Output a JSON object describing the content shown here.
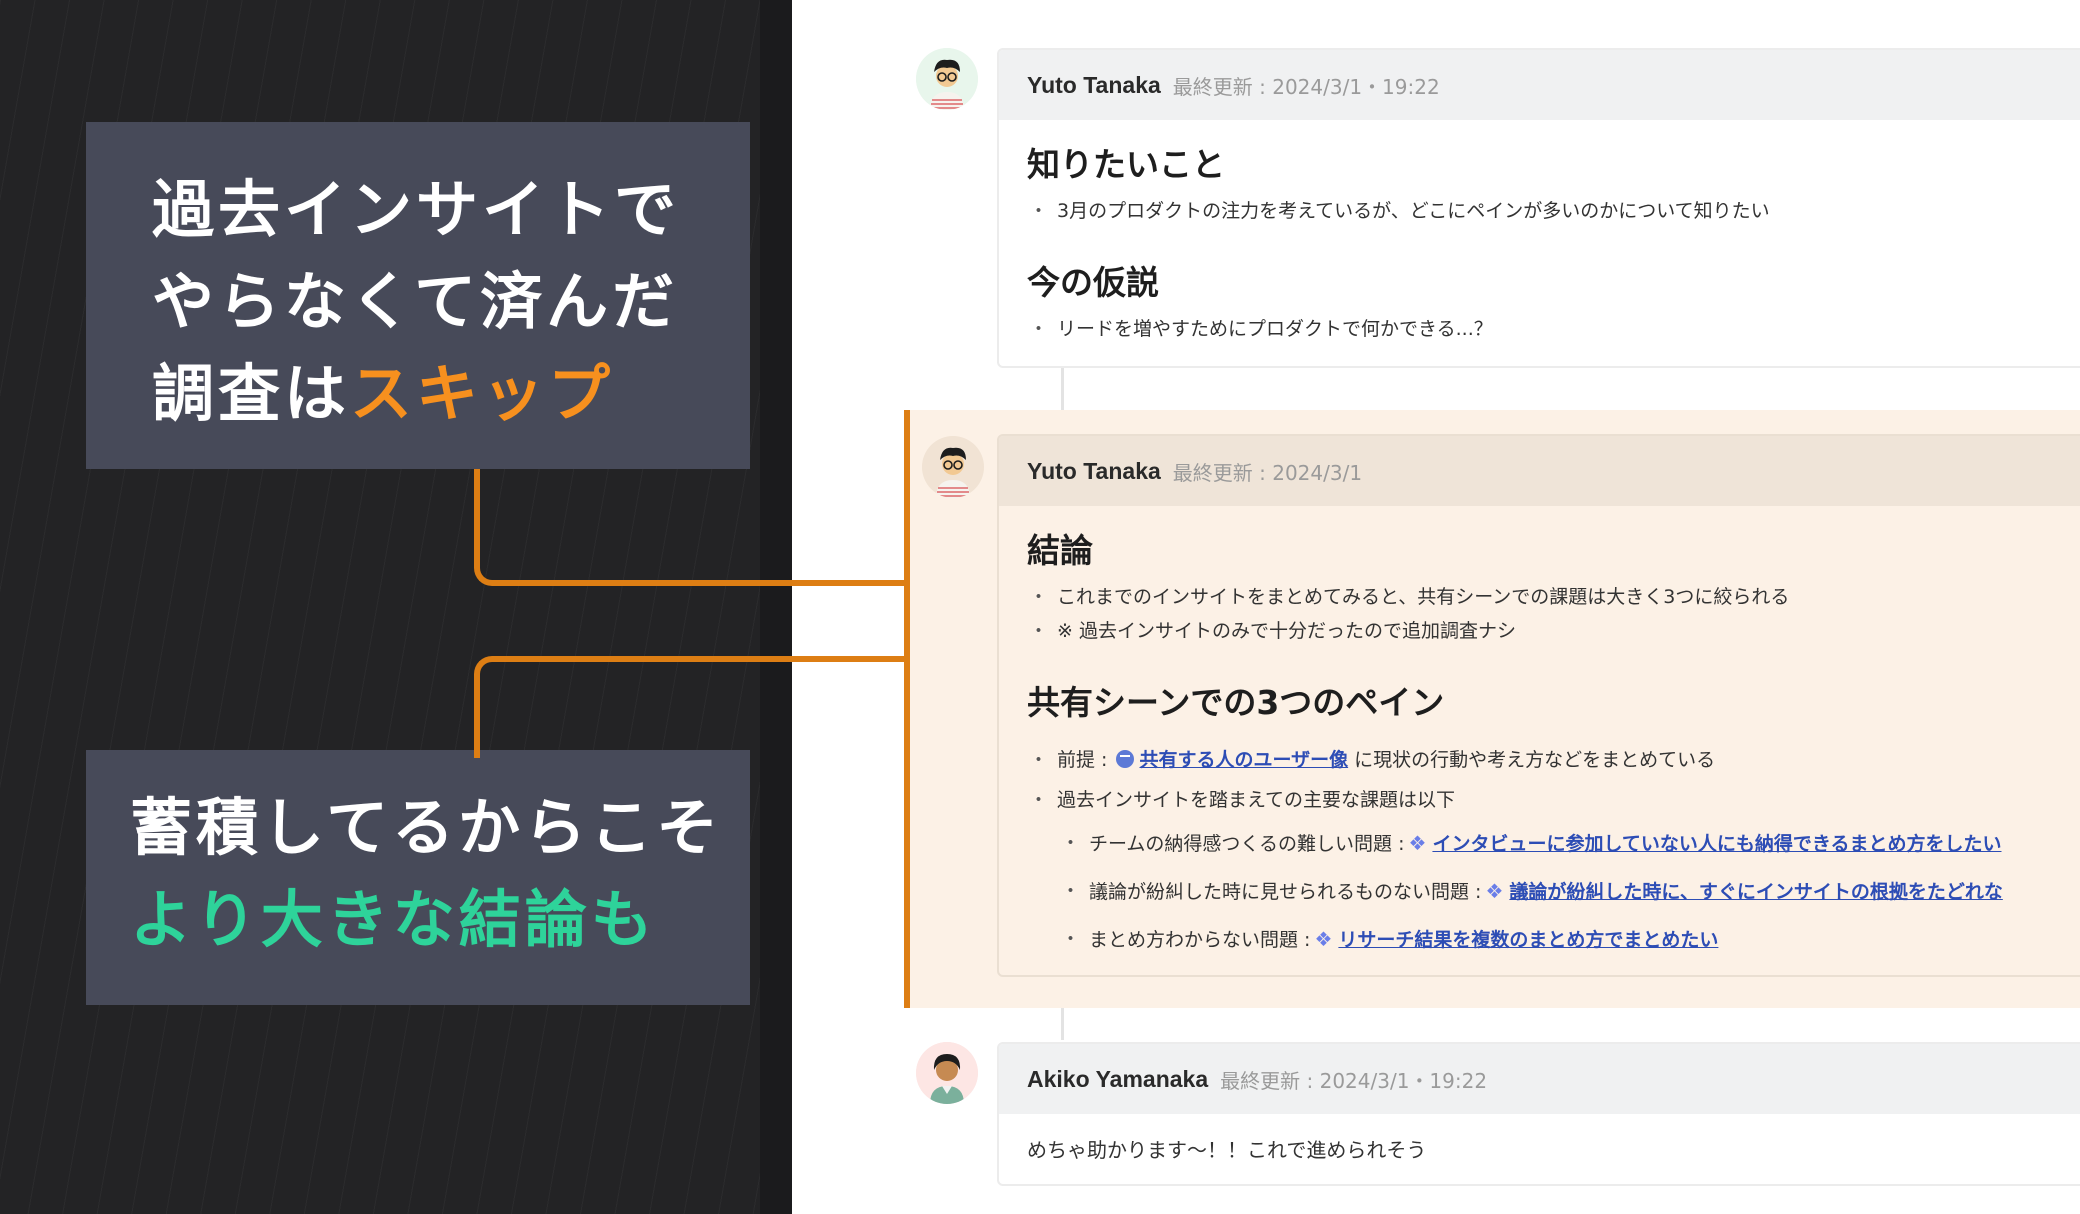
{
  "callouts": {
    "top": {
      "line1": "過去インサイトで",
      "line2": "やらなくて済んだ",
      "line3_prefix": "調査は",
      "line3_accent": "スキップ"
    },
    "bottom": {
      "line1": "蓄積してるからこそ",
      "line2_accent": "より大きな結論も"
    }
  },
  "colors": {
    "orange": "#f7901e",
    "green": "#2ed39a",
    "connector": "#dd7e14",
    "link": "#2d4db5"
  },
  "posts": [
    {
      "author": "Yuto Tanaka",
      "meta": "最終更新 : 2024/3/1・19:22",
      "sections": [
        {
          "heading": "知りたいこと",
          "bullets": [
            "3月のプロダクトの注力を考えているが、どこにペインが多いのかについて知りたい"
          ]
        },
        {
          "heading": "今の仮説",
          "bullets": [
            "リードを増やすためにプロダクトで何かできる...？"
          ]
        }
      ]
    },
    {
      "author": "Yuto Tanaka",
      "meta": "最終更新 : 2024/3/1",
      "conclusion": {
        "heading": "結論",
        "bullets": [
          "これまでのインサイトをまとめてみると、共有シーンでの課題は大きく3つに絞られる",
          "※ 過去インサイトのみで十分だったので追加調査ナシ"
        ]
      },
      "pains": {
        "heading": "共有シーンでの3つのペイン",
        "premise_label": "前提 :",
        "premise_link": "共有する人のユーザー像",
        "premise_suffix": "に現状の行動や考え方などをまとめている",
        "summary": "過去インサイトを踏まえての主要な課題は以下",
        "items": [
          {
            "label": "チームの納得感つくるの難しい問題 :",
            "link": "インタビューに参加していない人にも納得できるまとめ方をしたい"
          },
          {
            "label": "議論が紛糾した時に見せられるものない問題 :",
            "link": "議論が紛糾した時に、すぐにインサイトの根拠をたどれな"
          },
          {
            "label": "まとめ方わからない問題 :",
            "link": "リサーチ結果を複数のまとめ方でまとめたい"
          }
        ]
      }
    },
    {
      "author": "Akiko Yamanaka",
      "meta": "最終更新 : 2024/3/1・19:22",
      "text": "めちゃ助かります〜！！これで進められそう"
    }
  ],
  "icons": {
    "notion_page": "notion-page-icon",
    "people": "people-icon"
  }
}
